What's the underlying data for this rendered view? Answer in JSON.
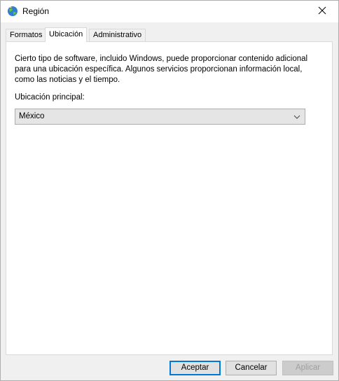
{
  "window": {
    "title": "Región",
    "icon": "globe-icon",
    "close_icon": "close-icon"
  },
  "tabs": [
    {
      "label": "Formatos",
      "active": false
    },
    {
      "label": "Ubicación",
      "active": true
    },
    {
      "label": "Administrativo",
      "active": false
    }
  ],
  "location_tab": {
    "description": "Cierto tipo de software, incluido Windows, puede proporcionar contenido adicional para una ubicación específica. Algunos servicios proporcionan información local, como las noticias y el tiempo.",
    "home_location_label": "Ubicación principal:",
    "home_location_value": "México"
  },
  "buttons": {
    "ok": "Aceptar",
    "cancel": "Cancelar",
    "apply": "Aplicar"
  },
  "colors": {
    "accent": "#0078d7",
    "window_bg": "#f0f0f0",
    "panel_bg": "#ffffff"
  }
}
